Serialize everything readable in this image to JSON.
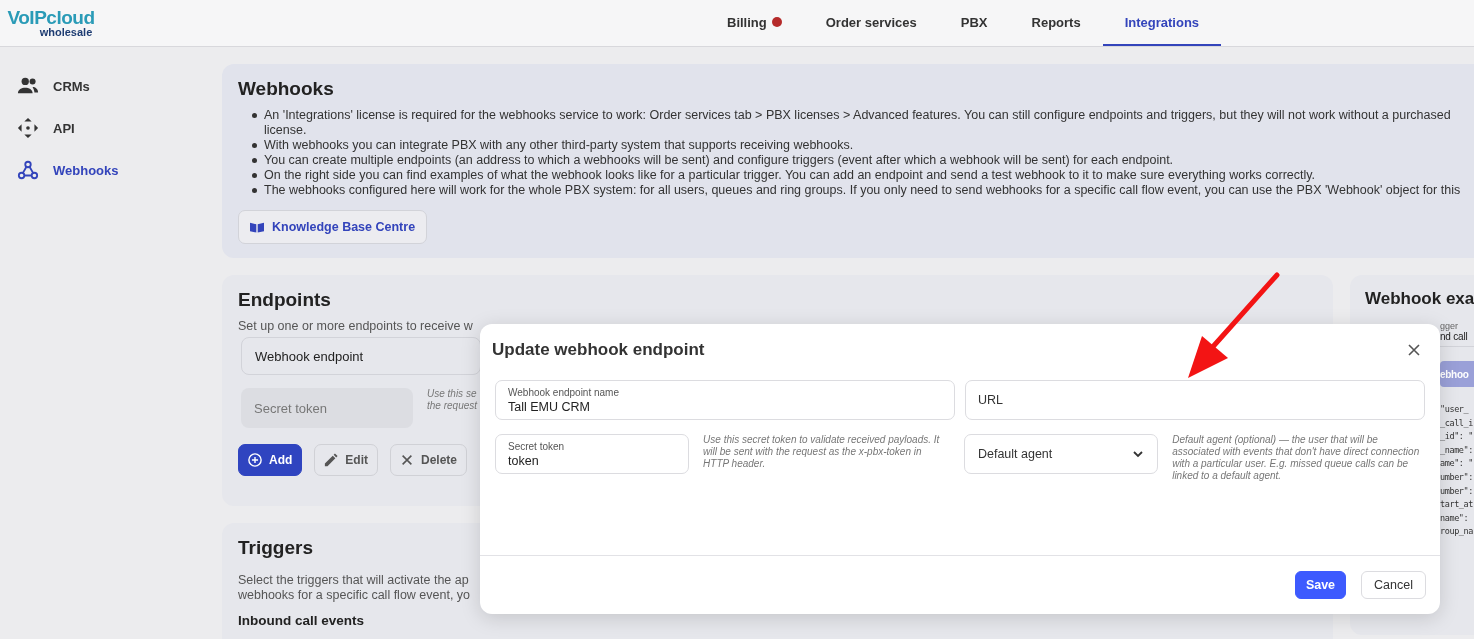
{
  "header": {
    "logo": {
      "brand": "VoIPcloud",
      "tag": "wholesale"
    },
    "nav": [
      {
        "label": "Billing",
        "selected": false,
        "alert": true
      },
      {
        "label": "Order services",
        "selected": false,
        "alert": false
      },
      {
        "label": "PBX",
        "selected": false,
        "alert": false
      },
      {
        "label": "Reports",
        "selected": false,
        "alert": false
      },
      {
        "label": "Integrations",
        "selected": true,
        "alert": false
      }
    ]
  },
  "sidebar": {
    "items": [
      {
        "label": "CRMs",
        "selected": false
      },
      {
        "label": "API",
        "selected": false
      },
      {
        "label": "Webhooks",
        "selected": true
      }
    ]
  },
  "webhooks": {
    "title": "Webhooks",
    "bullets": [
      {
        "lines": [
          "An 'Integrations' license is required for the webhooks service to work: Order services tab > PBX licenses > Advanced features. You can still configure endpoints and triggers, but they will not work without a purchased",
          "license."
        ]
      },
      {
        "lines": [
          "With webhooks you can integrate PBX with any other third-party system that supports receiving webhooks."
        ]
      },
      {
        "lines": [
          "You can create multiple endpoints (an address to which a webhooks will be sent) and configure triggers (event after which a webhook will be sent) for each endpoint."
        ]
      },
      {
        "lines": [
          "On the right side you can find examples of what the webhook looks like for a particular trigger. You can add an endpoint and send a test webhook to it to make sure everything works correctly."
        ]
      },
      {
        "lines": [
          "The webhooks configured here will work for the whole PBX system: for all users, queues and ring groups. If you only need to send webhooks for a specific call flow event, you can use the PBX 'Webhook' object for this"
        ]
      }
    ],
    "kb_button": "Knowledge Base Centre"
  },
  "endpoints": {
    "title": "Endpoints",
    "intro": "Set up one or more endpoints to receive w",
    "endpoint_field": "Webhook endpoint",
    "secret_placeholder": "Secret token",
    "hint_lines": [
      "Use this se",
      "the request"
    ],
    "buttons": [
      {
        "label": "Add",
        "kind": "primary"
      },
      {
        "label": "Edit",
        "kind": "edit"
      },
      {
        "label": "Delete",
        "kind": "delete"
      }
    ]
  },
  "triggers": {
    "title": "Triggers",
    "intro_lines": [
      "Select the triggers that will activate the ap",
      "webhooks for a specific call flow event, yo"
    ],
    "section": "Inbound call events"
  },
  "examples": {
    "title": "Webhook exa",
    "trigger_label": "gger",
    "trigger_value": "nd call",
    "button": "ebhoo",
    "code_lines": [
      "\"user_",
      "_call_i",
      "_id\": \"",
      "_name\":",
      "ame\": \"",
      "umber\":",
      "umber\":",
      "tart_at",
      "name\":",
      "roup_na"
    ]
  },
  "modal": {
    "title": "Update webhook endpoint",
    "name_field": {
      "label": "Webhook endpoint name",
      "value": "Tall EMU CRM"
    },
    "url_field": {
      "placeholder": "URL"
    },
    "secret_field": {
      "label": "Secret token",
      "value": "token"
    },
    "secret_hint": "Use this secret token to validate received payloads. It will be sent with the request as the x-pbx-token in HTTP header.",
    "agent_select": {
      "value": "Default agent"
    },
    "agent_hint": "Default agent (optional) — the user that will be associated with events that don't have direct connection with a particular user. E.g. missed queue calls can be linked to a default agent.",
    "buttons": [
      {
        "label": "Save",
        "kind": "primary"
      },
      {
        "label": "Cancel",
        "kind": "secondary"
      }
    ]
  }
}
